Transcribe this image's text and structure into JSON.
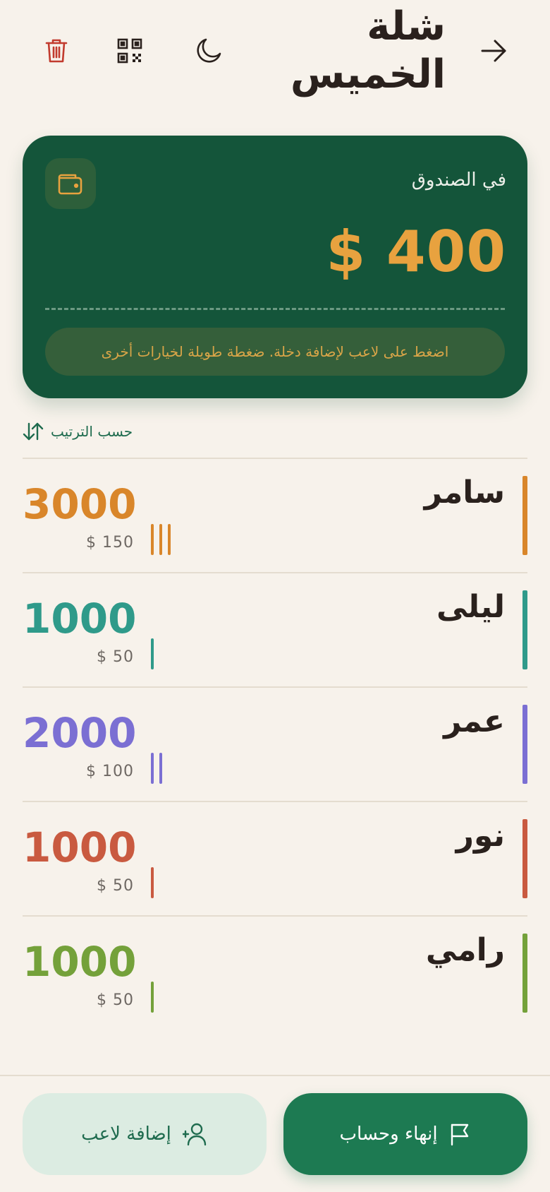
{
  "header": {
    "title": "شلة الخميس",
    "icons": [
      "arrow-right-icon",
      "moon-icon",
      "qr-code-icon",
      "trash-icon"
    ]
  },
  "fund": {
    "label": "في الصندوق",
    "amount": "$ 400",
    "hint": "اضغط على لاعب لإضافة دخلة. ضغطة طويلة لخيارات أخرى",
    "icon": "wallet-icon",
    "accent": "#e8a23f",
    "background": "#14553a"
  },
  "sort": {
    "label": "حسب الترتيب",
    "icon": "sort-arrows-icon"
  },
  "players": [
    {
      "name": "سامر",
      "score": "3000",
      "money": "$ 150",
      "entries": 3,
      "color": "#d9862a"
    },
    {
      "name": "ليلى",
      "score": "1000",
      "money": "$ 50",
      "entries": 1,
      "color": "#2f9a8a"
    },
    {
      "name": "عمر",
      "score": "2000",
      "money": "$ 100",
      "entries": 2,
      "color": "#7b6fd3"
    },
    {
      "name": "نور",
      "score": "1000",
      "money": "$ 50",
      "entries": 1,
      "color": "#c95a40"
    },
    {
      "name": "رامي",
      "score": "1000",
      "money": "$ 50",
      "entries": 1,
      "color": "#74a13a"
    }
  ],
  "actions": {
    "add_player": "إضافة لاعب",
    "finish": "إنهاء وحساب"
  }
}
